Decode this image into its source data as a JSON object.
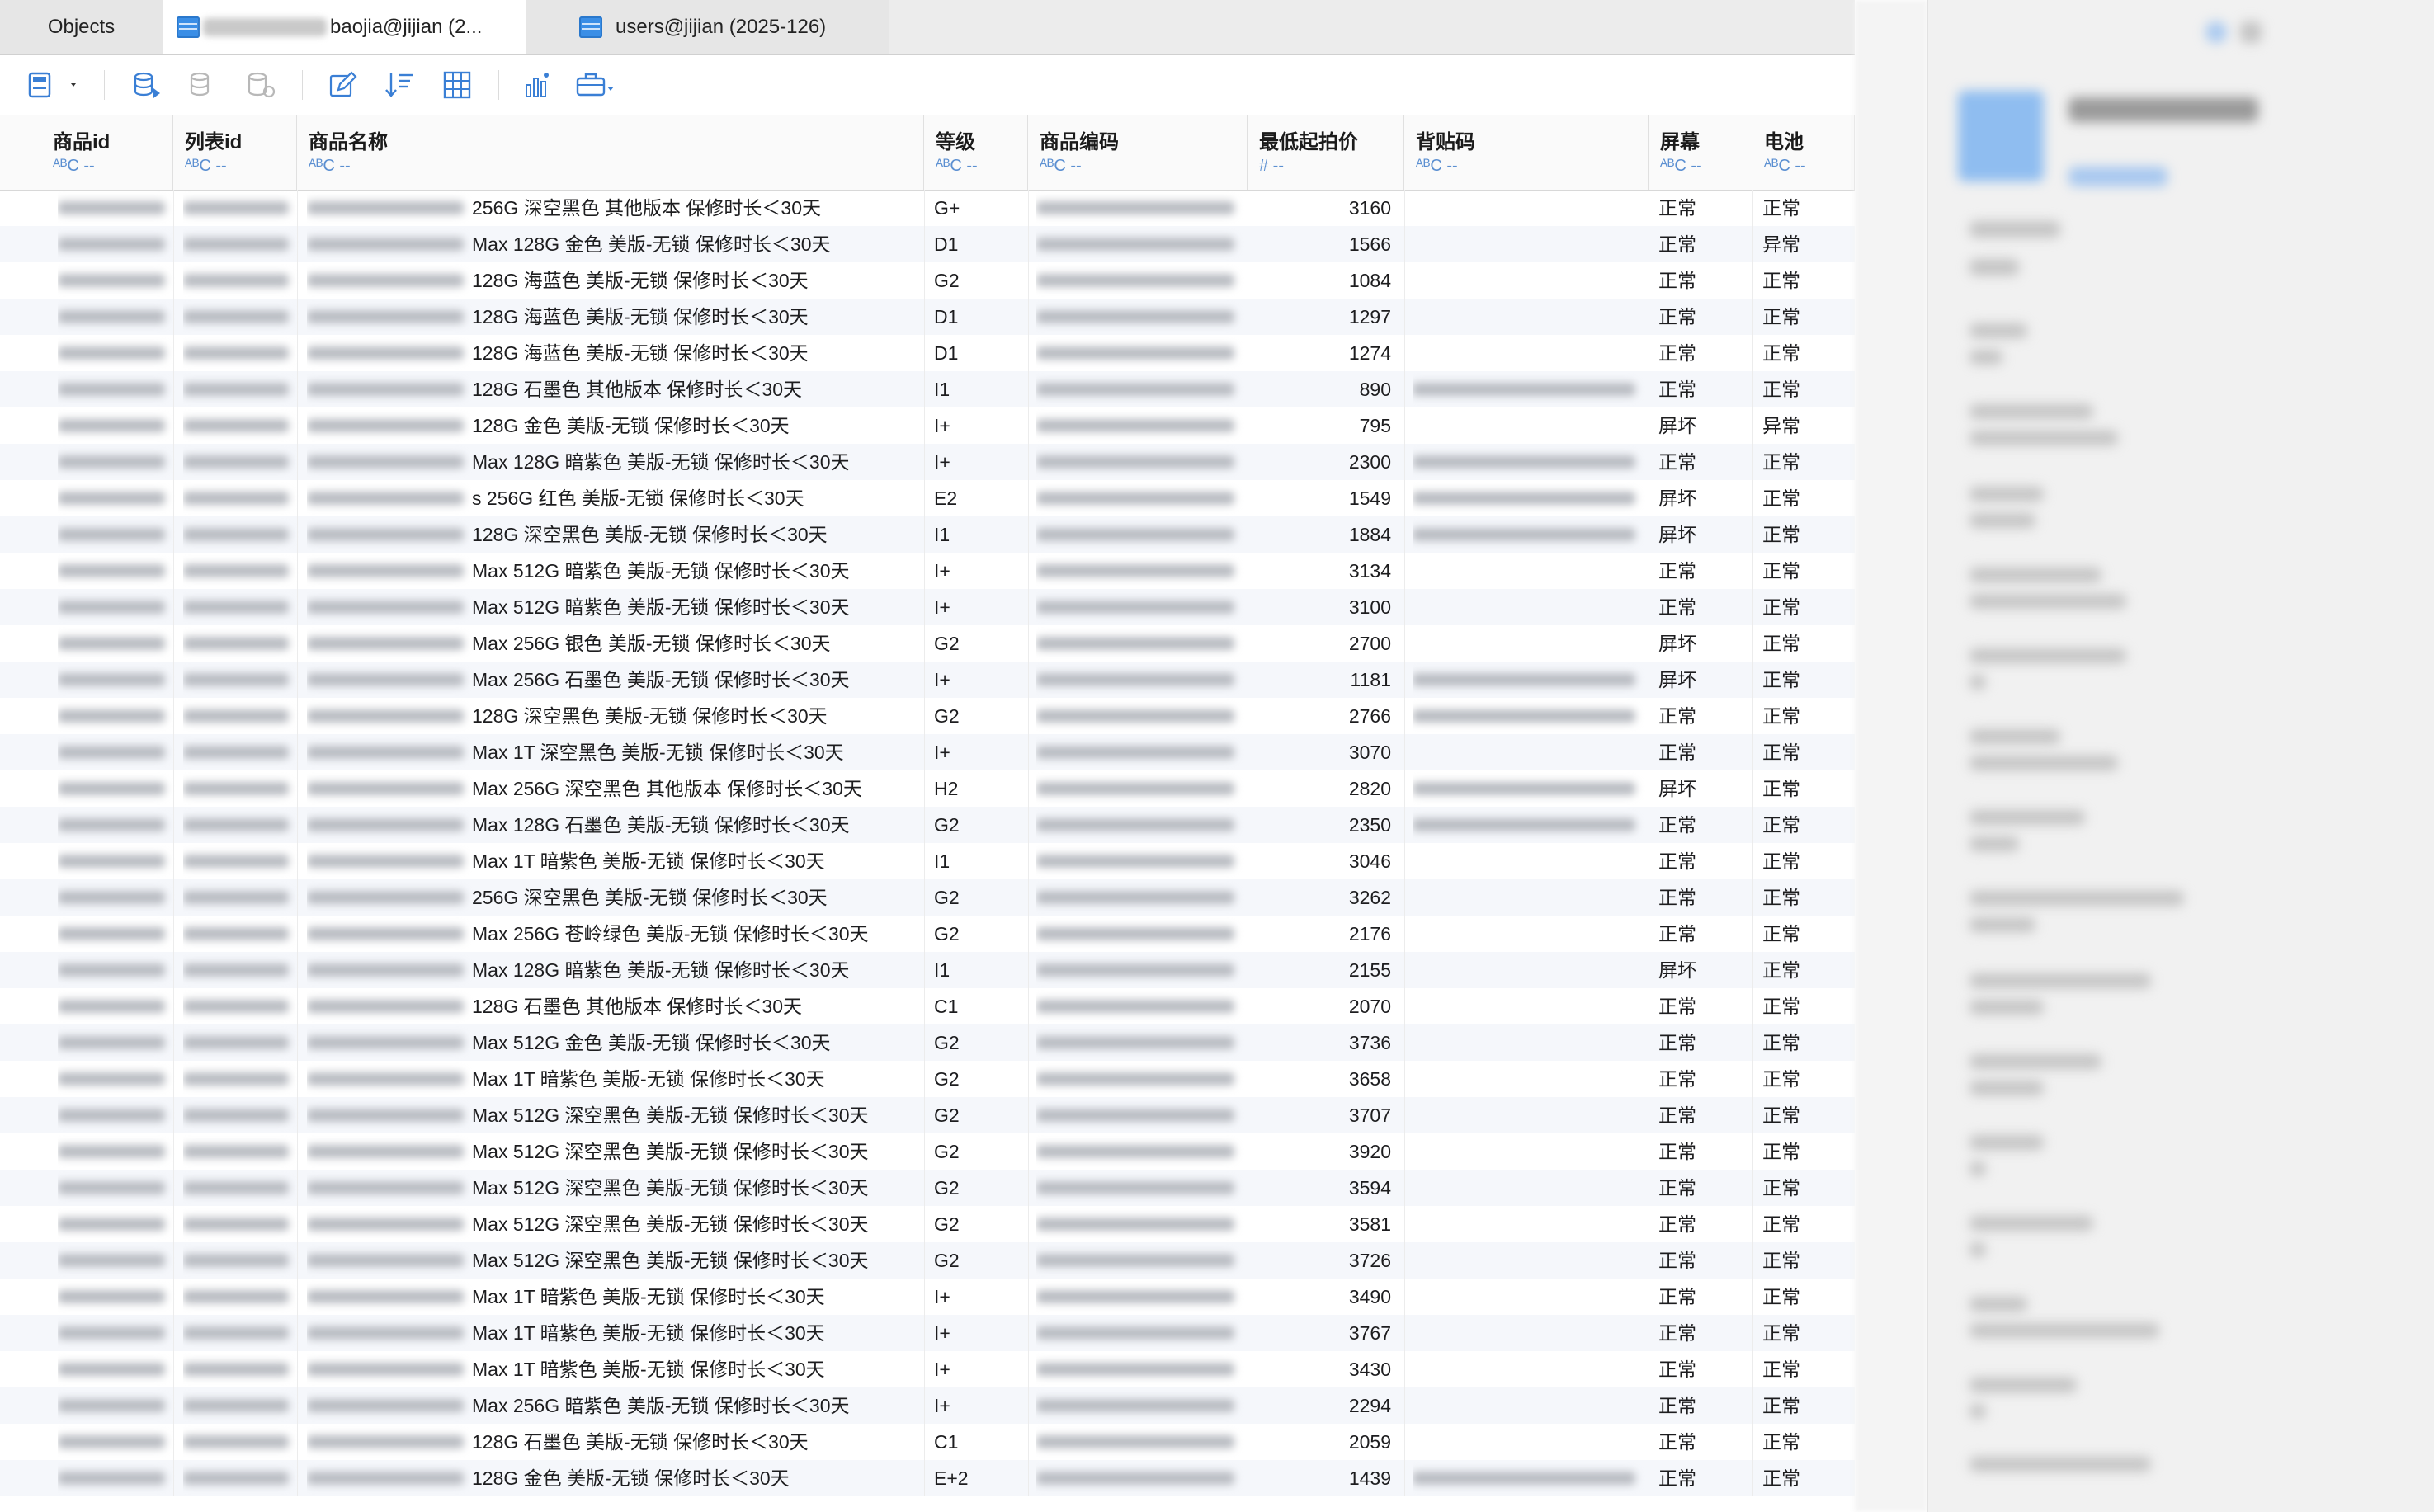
{
  "tabs": [
    {
      "label": "Objects"
    },
    {
      "label": "baojia@jijian (2..."
    },
    {
      "label": "users@jijian (2025-126)"
    }
  ],
  "toolbar": {
    "icons": [
      "table-save-icon",
      "dropdown-chevron-icon",
      "db-add-icon",
      "db-remove-icon",
      "db-refresh-icon",
      "edit-icon",
      "sort-filter-icon",
      "grid-view-icon",
      "chart-icon",
      "export-icon"
    ]
  },
  "columns": [
    {
      "title": "商品id",
      "type": "ABC"
    },
    {
      "title": "列表id",
      "type": "ABC"
    },
    {
      "title": "商品名称",
      "type": "ABC"
    },
    {
      "title": "等级",
      "type": "ABC"
    },
    {
      "title": "商品编码",
      "type": "ABC"
    },
    {
      "title": "最低起拍价",
      "type": "#"
    },
    {
      "title": "背贴码",
      "type": "ABC"
    },
    {
      "title": "屏幕",
      "type": "ABC"
    },
    {
      "title": "电池",
      "type": "ABC"
    }
  ],
  "rows": [
    {
      "name": "256G 深空黑色 其他版本 保修时长＜30天",
      "grade": "G+",
      "price": "3160",
      "back": false,
      "screen": "正常",
      "battery": "正常"
    },
    {
      "name": "Max 128G 金色 美版-无锁 保修时长＜30天",
      "grade": "D1",
      "price": "1566",
      "back": false,
      "screen": "正常",
      "battery": "异常"
    },
    {
      "name": "128G 海蓝色 美版-无锁 保修时长＜30天",
      "grade": "G2",
      "price": "1084",
      "back": false,
      "screen": "正常",
      "battery": "正常"
    },
    {
      "name": "128G 海蓝色 美版-无锁 保修时长＜30天",
      "grade": "D1",
      "price": "1297",
      "back": false,
      "screen": "正常",
      "battery": "正常"
    },
    {
      "name": "128G 海蓝色 美版-无锁 保修时长＜30天",
      "grade": "D1",
      "price": "1274",
      "back": false,
      "screen": "正常",
      "battery": "正常"
    },
    {
      "name": "128G 石墨色 其他版本 保修时长＜30天",
      "grade": "I1",
      "price": "890",
      "back": true,
      "screen": "正常",
      "battery": "正常"
    },
    {
      "name": "128G 金色 美版-无锁 保修时长＜30天",
      "grade": "I+",
      "price": "795",
      "back": false,
      "screen": "屏坏",
      "battery": "异常"
    },
    {
      "name": "Max 128G 暗紫色 美版-无锁 保修时长＜30天",
      "grade": "I+",
      "price": "2300",
      "back": true,
      "screen": "正常",
      "battery": "正常"
    },
    {
      "name": "s 256G 红色 美版-无锁 保修时长＜30天",
      "grade": "E2",
      "price": "1549",
      "back": true,
      "screen": "屏坏",
      "battery": "正常"
    },
    {
      "name": "128G 深空黑色 美版-无锁 保修时长＜30天",
      "grade": "I1",
      "price": "1884",
      "back": true,
      "screen": "屏坏",
      "battery": "正常"
    },
    {
      "name": "Max 512G 暗紫色 美版-无锁 保修时长＜30天",
      "grade": "I+",
      "price": "3134",
      "back": false,
      "screen": "正常",
      "battery": "正常"
    },
    {
      "name": "Max 512G 暗紫色 美版-无锁 保修时长＜30天",
      "grade": "I+",
      "price": "3100",
      "back": false,
      "screen": "正常",
      "battery": "正常"
    },
    {
      "name": "Max 256G 银色 美版-无锁 保修时长＜30天",
      "grade": "G2",
      "price": "2700",
      "back": false,
      "screen": "屏坏",
      "battery": "正常"
    },
    {
      "name": "Max 256G 石墨色 美版-无锁 保修时长＜30天",
      "grade": "I+",
      "price": "1181",
      "back": true,
      "screen": "屏坏",
      "battery": "正常"
    },
    {
      "name": "128G 深空黑色 美版-无锁 保修时长＜30天",
      "grade": "G2",
      "price": "2766",
      "back": true,
      "screen": "正常",
      "battery": "正常"
    },
    {
      "name": "Max 1T 深空黑色 美版-无锁 保修时长＜30天",
      "grade": "I+",
      "price": "3070",
      "back": false,
      "screen": "正常",
      "battery": "正常"
    },
    {
      "name": "Max 256G 深空黑色 其他版本 保修时长＜30天",
      "grade": "H2",
      "price": "2820",
      "back": true,
      "screen": "屏坏",
      "battery": "正常"
    },
    {
      "name": "Max 128G 石墨色 美版-无锁 保修时长＜30天",
      "grade": "G2",
      "price": "2350",
      "back": true,
      "screen": "正常",
      "battery": "正常"
    },
    {
      "name": "Max 1T 暗紫色 美版-无锁 保修时长＜30天",
      "grade": "I1",
      "price": "3046",
      "back": false,
      "screen": "正常",
      "battery": "正常"
    },
    {
      "name": "256G 深空黑色 美版-无锁 保修时长＜30天",
      "grade": "G2",
      "price": "3262",
      "back": false,
      "screen": "正常",
      "battery": "正常"
    },
    {
      "name": "Max 256G 苍岭绿色 美版-无锁 保修时长＜30天",
      "grade": "G2",
      "price": "2176",
      "back": false,
      "screen": "正常",
      "battery": "正常"
    },
    {
      "name": "Max 128G 暗紫色 美版-无锁 保修时长＜30天",
      "grade": "I1",
      "price": "2155",
      "back": false,
      "screen": "屏坏",
      "battery": "正常"
    },
    {
      "name": "128G 石墨色 其他版本 保修时长＜30天",
      "grade": "C1",
      "price": "2070",
      "back": false,
      "screen": "正常",
      "battery": "正常"
    },
    {
      "name": "Max 512G 金色 美版-无锁 保修时长＜30天",
      "grade": "G2",
      "price": "3736",
      "back": false,
      "screen": "正常",
      "battery": "正常"
    },
    {
      "name": "Max 1T 暗紫色 美版-无锁 保修时长＜30天",
      "grade": "G2",
      "price": "3658",
      "back": false,
      "screen": "正常",
      "battery": "正常"
    },
    {
      "name": "Max 512G 深空黑色 美版-无锁 保修时长＜30天",
      "grade": "G2",
      "price": "3707",
      "back": false,
      "screen": "正常",
      "battery": "正常"
    },
    {
      "name": "Max 512G 深空黑色 美版-无锁 保修时长＜30天",
      "grade": "G2",
      "price": "3920",
      "back": false,
      "screen": "正常",
      "battery": "正常"
    },
    {
      "name": "Max 512G 深空黑色 美版-无锁 保修时长＜30天",
      "grade": "G2",
      "price": "3594",
      "back": false,
      "screen": "正常",
      "battery": "正常"
    },
    {
      "name": "Max 512G 深空黑色 美版-无锁 保修时长＜30天",
      "grade": "G2",
      "price": "3581",
      "back": false,
      "screen": "正常",
      "battery": "正常"
    },
    {
      "name": "Max 512G 深空黑色 美版-无锁 保修时长＜30天",
      "grade": "G2",
      "price": "3726",
      "back": false,
      "screen": "正常",
      "battery": "正常"
    },
    {
      "name": "Max 1T 暗紫色 美版-无锁 保修时长＜30天",
      "grade": "I+",
      "price": "3490",
      "back": false,
      "screen": "正常",
      "battery": "正常"
    },
    {
      "name": "Max 1T 暗紫色 美版-无锁 保修时长＜30天",
      "grade": "I+",
      "price": "3767",
      "back": false,
      "screen": "正常",
      "battery": "正常"
    },
    {
      "name": "Max 1T 暗紫色 美版-无锁 保修时长＜30天",
      "grade": "I+",
      "price": "3430",
      "back": false,
      "screen": "正常",
      "battery": "正常"
    },
    {
      "name": "Max 256G 暗紫色 美版-无锁 保修时长＜30天",
      "grade": "I+",
      "price": "2294",
      "back": false,
      "screen": "正常",
      "battery": "正常"
    },
    {
      "name": "128G 石墨色 美版-无锁 保修时长＜30天",
      "grade": "C1",
      "price": "2059",
      "back": false,
      "screen": "正常",
      "battery": "正常"
    },
    {
      "name": "128G 金色 美版-无锁 保修时长＜30天",
      "grade": "E+2",
      "price": "1439",
      "back": true,
      "screen": "正常",
      "battery": "正常"
    }
  ],
  "colors": {
    "accent": "#3a8ee6",
    "type_hint": "#5b8fd1",
    "row_alt": "#f5f7fb"
  }
}
